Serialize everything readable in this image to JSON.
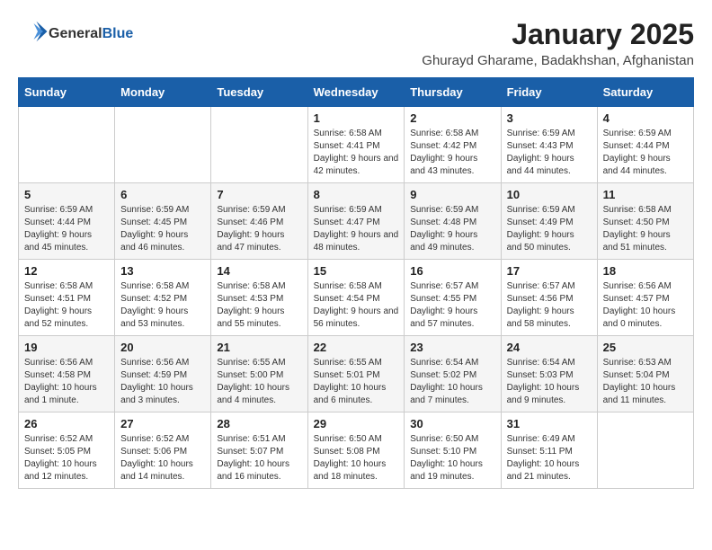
{
  "header": {
    "logo_general": "General",
    "logo_blue": "Blue",
    "title": "January 2025",
    "subtitle": "Ghurayd Gharame, Badakhshan, Afghanistan"
  },
  "days_of_week": [
    "Sunday",
    "Monday",
    "Tuesday",
    "Wednesday",
    "Thursday",
    "Friday",
    "Saturday"
  ],
  "weeks": [
    [
      {
        "day": "",
        "info": ""
      },
      {
        "day": "",
        "info": ""
      },
      {
        "day": "",
        "info": ""
      },
      {
        "day": "1",
        "info": "Sunrise: 6:58 AM\nSunset: 4:41 PM\nDaylight: 9 hours and 42 minutes."
      },
      {
        "day": "2",
        "info": "Sunrise: 6:58 AM\nSunset: 4:42 PM\nDaylight: 9 hours and 43 minutes."
      },
      {
        "day": "3",
        "info": "Sunrise: 6:59 AM\nSunset: 4:43 PM\nDaylight: 9 hours and 44 minutes."
      },
      {
        "day": "4",
        "info": "Sunrise: 6:59 AM\nSunset: 4:44 PM\nDaylight: 9 hours and 44 minutes."
      }
    ],
    [
      {
        "day": "5",
        "info": "Sunrise: 6:59 AM\nSunset: 4:44 PM\nDaylight: 9 hours and 45 minutes."
      },
      {
        "day": "6",
        "info": "Sunrise: 6:59 AM\nSunset: 4:45 PM\nDaylight: 9 hours and 46 minutes."
      },
      {
        "day": "7",
        "info": "Sunrise: 6:59 AM\nSunset: 4:46 PM\nDaylight: 9 hours and 47 minutes."
      },
      {
        "day": "8",
        "info": "Sunrise: 6:59 AM\nSunset: 4:47 PM\nDaylight: 9 hours and 48 minutes."
      },
      {
        "day": "9",
        "info": "Sunrise: 6:59 AM\nSunset: 4:48 PM\nDaylight: 9 hours and 49 minutes."
      },
      {
        "day": "10",
        "info": "Sunrise: 6:59 AM\nSunset: 4:49 PM\nDaylight: 9 hours and 50 minutes."
      },
      {
        "day": "11",
        "info": "Sunrise: 6:58 AM\nSunset: 4:50 PM\nDaylight: 9 hours and 51 minutes."
      }
    ],
    [
      {
        "day": "12",
        "info": "Sunrise: 6:58 AM\nSunset: 4:51 PM\nDaylight: 9 hours and 52 minutes."
      },
      {
        "day": "13",
        "info": "Sunrise: 6:58 AM\nSunset: 4:52 PM\nDaylight: 9 hours and 53 minutes."
      },
      {
        "day": "14",
        "info": "Sunrise: 6:58 AM\nSunset: 4:53 PM\nDaylight: 9 hours and 55 minutes."
      },
      {
        "day": "15",
        "info": "Sunrise: 6:58 AM\nSunset: 4:54 PM\nDaylight: 9 hours and 56 minutes."
      },
      {
        "day": "16",
        "info": "Sunrise: 6:57 AM\nSunset: 4:55 PM\nDaylight: 9 hours and 57 minutes."
      },
      {
        "day": "17",
        "info": "Sunrise: 6:57 AM\nSunset: 4:56 PM\nDaylight: 9 hours and 58 minutes."
      },
      {
        "day": "18",
        "info": "Sunrise: 6:56 AM\nSunset: 4:57 PM\nDaylight: 10 hours and 0 minutes."
      }
    ],
    [
      {
        "day": "19",
        "info": "Sunrise: 6:56 AM\nSunset: 4:58 PM\nDaylight: 10 hours and 1 minute."
      },
      {
        "day": "20",
        "info": "Sunrise: 6:56 AM\nSunset: 4:59 PM\nDaylight: 10 hours and 3 minutes."
      },
      {
        "day": "21",
        "info": "Sunrise: 6:55 AM\nSunset: 5:00 PM\nDaylight: 10 hours and 4 minutes."
      },
      {
        "day": "22",
        "info": "Sunrise: 6:55 AM\nSunset: 5:01 PM\nDaylight: 10 hours and 6 minutes."
      },
      {
        "day": "23",
        "info": "Sunrise: 6:54 AM\nSunset: 5:02 PM\nDaylight: 10 hours and 7 minutes."
      },
      {
        "day": "24",
        "info": "Sunrise: 6:54 AM\nSunset: 5:03 PM\nDaylight: 10 hours and 9 minutes."
      },
      {
        "day": "25",
        "info": "Sunrise: 6:53 AM\nSunset: 5:04 PM\nDaylight: 10 hours and 11 minutes."
      }
    ],
    [
      {
        "day": "26",
        "info": "Sunrise: 6:52 AM\nSunset: 5:05 PM\nDaylight: 10 hours and 12 minutes."
      },
      {
        "day": "27",
        "info": "Sunrise: 6:52 AM\nSunset: 5:06 PM\nDaylight: 10 hours and 14 minutes."
      },
      {
        "day": "28",
        "info": "Sunrise: 6:51 AM\nSunset: 5:07 PM\nDaylight: 10 hours and 16 minutes."
      },
      {
        "day": "29",
        "info": "Sunrise: 6:50 AM\nSunset: 5:08 PM\nDaylight: 10 hours and 18 minutes."
      },
      {
        "day": "30",
        "info": "Sunrise: 6:50 AM\nSunset: 5:10 PM\nDaylight: 10 hours and 19 minutes."
      },
      {
        "day": "31",
        "info": "Sunrise: 6:49 AM\nSunset: 5:11 PM\nDaylight: 10 hours and 21 minutes."
      },
      {
        "day": "",
        "info": ""
      }
    ]
  ]
}
